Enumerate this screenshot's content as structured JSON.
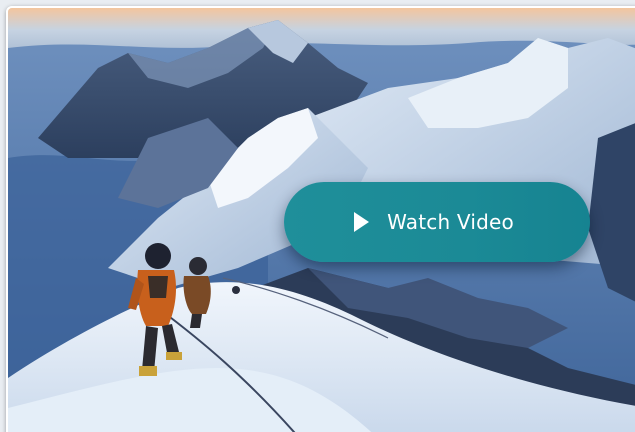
{
  "video_card": {
    "watch_label": "Watch Video",
    "play_icon": "play-icon",
    "thumbnail": "climbers-on-snowy-mountain-ridge"
  },
  "colors": {
    "button_bg": "#1b8a96",
    "button_text": "#ffffff",
    "card_border": "#ffffff"
  }
}
